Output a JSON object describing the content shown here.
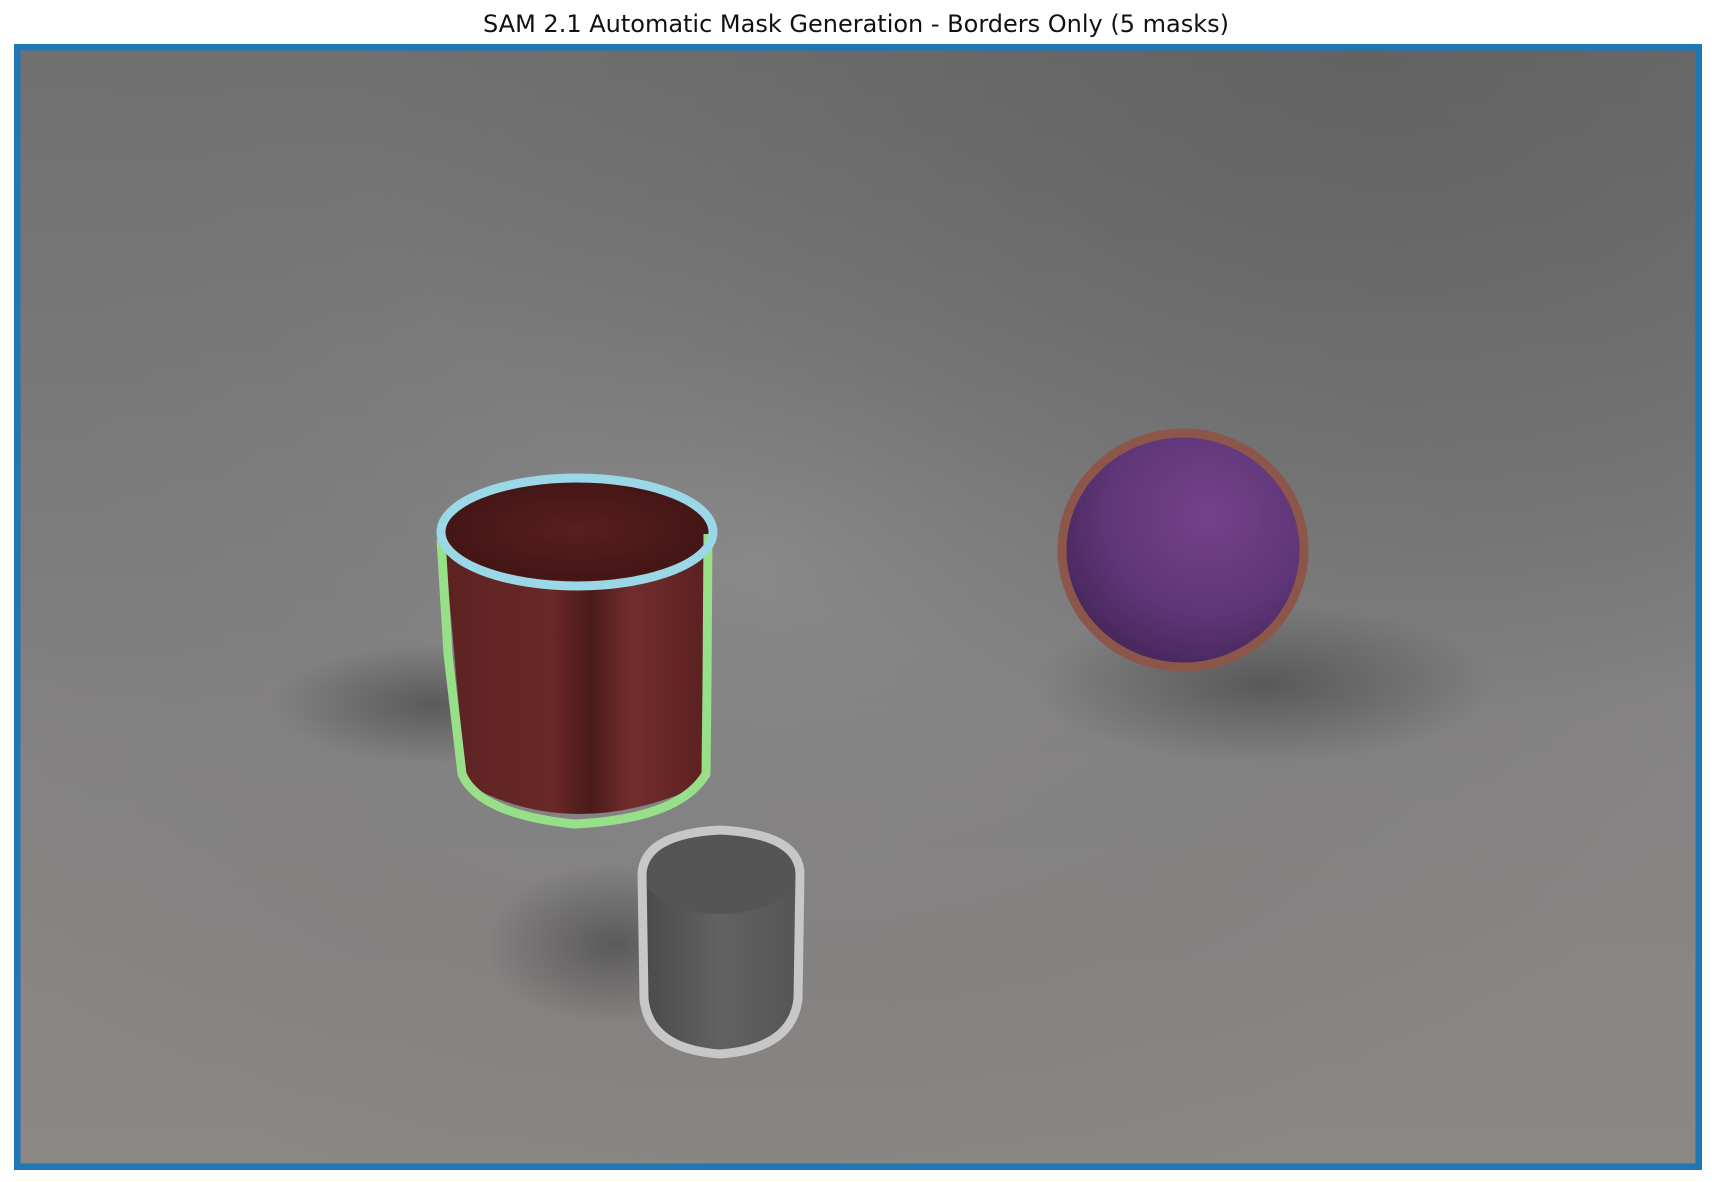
{
  "figure": {
    "title": "SAM 2.1 Automatic Mask Generation - Borders Only (5 masks)"
  },
  "masks": [
    {
      "object": "background",
      "border_color": "#1f77b4"
    },
    {
      "object": "red-cylinder-top",
      "border_color": "#9ad8e8"
    },
    {
      "object": "red-cylinder-body",
      "border_color": "#98df8a"
    },
    {
      "object": "purple-sphere",
      "border_color": "#8c564b"
    },
    {
      "object": "gray-cylinder",
      "border_color": "#c7c7c7"
    }
  ],
  "objects": {
    "red_cylinder_color": "#6e2a2a",
    "purple_sphere_color": "#5e3a78",
    "gray_cylinder_color": "#5f5f5f"
  }
}
